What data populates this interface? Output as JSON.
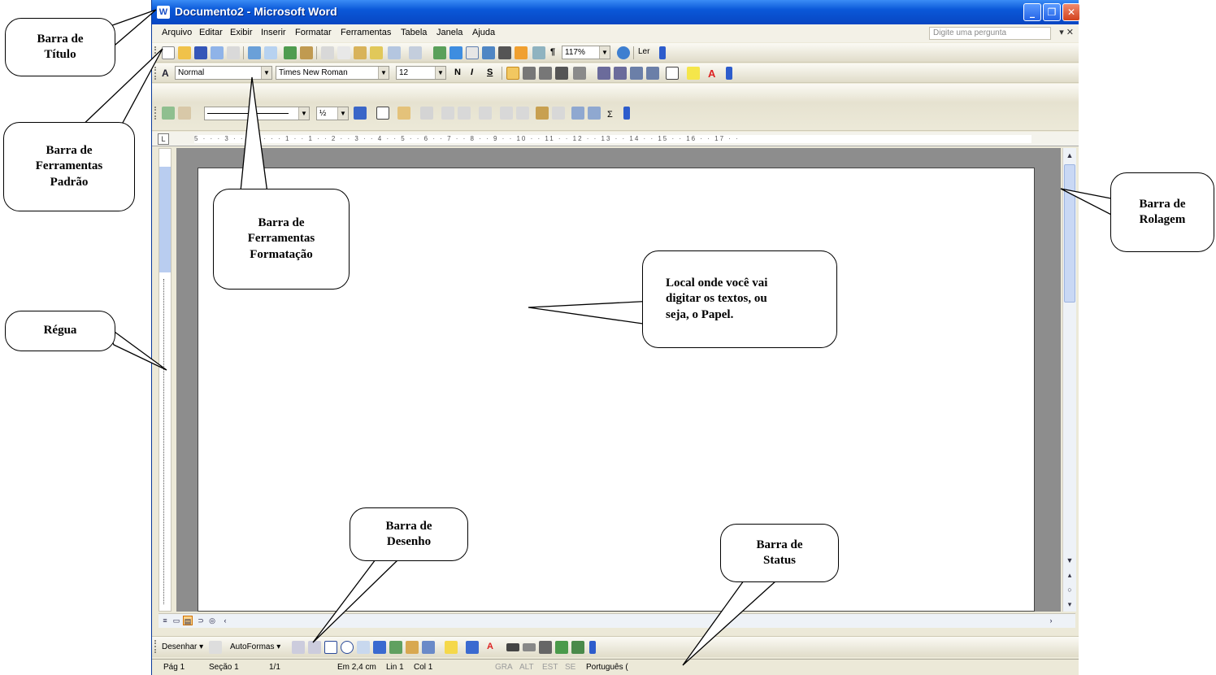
{
  "window": {
    "title": "Documento2 - Microsoft Word"
  },
  "menu": {
    "items": [
      "Arquivo",
      "Editar",
      "Exibir",
      "Inserir",
      "Formatar",
      "Ferramentas",
      "Tabela",
      "Janela",
      "Ajuda"
    ],
    "ask_placeholder": "Digite uma pergunta"
  },
  "standard_toolbar": {
    "zoom": "117%",
    "read_label": "Ler"
  },
  "formatting_toolbar": {
    "style": "Normal",
    "font": "Times New Roman",
    "size": "12",
    "bold": "N",
    "italic": "I",
    "underline": "S"
  },
  "tables_toolbar": {
    "line_weight": "½"
  },
  "ruler": {
    "marks": "5 · · · 3 · · · 1 · · · 1 · · 1 · · 2 · · 3 · · 4 · · 5 · · 6 · · 7 · · 8 · · 9 · · 10 · · 11 · · 12 · · 13 · · 14 · · 15 · · 16 · · 17 · ·"
  },
  "drawing_toolbar": {
    "draw_menu": "Desenhar ▾",
    "autoshapes_menu": "AutoFormas ▾"
  },
  "status_bar": {
    "page": "Pág 1",
    "section": "Seção 1",
    "pages": "1/1",
    "position": "Em 2,4 cm",
    "line": "Lin 1",
    "column": "Col 1",
    "rec": "GRA",
    "trk": "ALT",
    "ext": "EST",
    "ovr": "SE",
    "language": "Português ("
  },
  "annotations": {
    "title_bar": [
      "Barra de",
      "Título"
    ],
    "standard_toolbar": [
      "Barra de",
      "Ferramentas",
      "Padrão"
    ],
    "formatting_toolbar": [
      "Barra de",
      "Ferramentas",
      "Formatação"
    ],
    "ruler": [
      "Régua"
    ],
    "scroll_bar": [
      "Barra de",
      "Rolagem"
    ],
    "paper": [
      "Local onde você vai",
      "digitar os textos, ou",
      "seja, o Papel."
    ],
    "drawing_bar": [
      "Barra de",
      "Desenho"
    ],
    "status_bar": [
      "Barra de",
      "Status"
    ]
  }
}
